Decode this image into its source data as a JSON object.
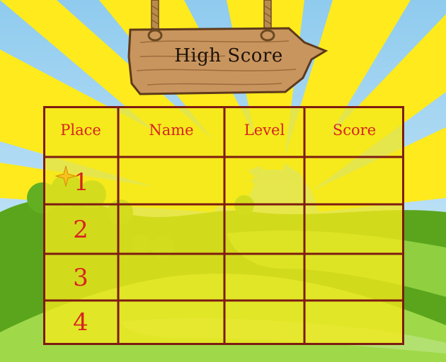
{
  "title": "High Score",
  "columns": [
    "Place",
    "Name",
    "Level",
    "Score"
  ],
  "rows": [
    {
      "place": "1",
      "name": "",
      "level": "",
      "score": ""
    },
    {
      "place": "2",
      "name": "",
      "level": "",
      "score": ""
    },
    {
      "place": "3",
      "name": "",
      "level": "",
      "score": ""
    },
    {
      "place": "4",
      "name": "",
      "level": "",
      "score": ""
    }
  ],
  "colors": {
    "sky": "#9fd3f0",
    "sunray": "#ffea1d",
    "table_fill": "#f4e91c",
    "grid_line": "#7d1b12",
    "text_red": "#d8231e",
    "hill_dark": "#5aa51c",
    "hill_light": "#9fd94a",
    "wood": "#c9955e"
  },
  "icons": {
    "first_place_marker": "sparkle-star-icon"
  }
}
